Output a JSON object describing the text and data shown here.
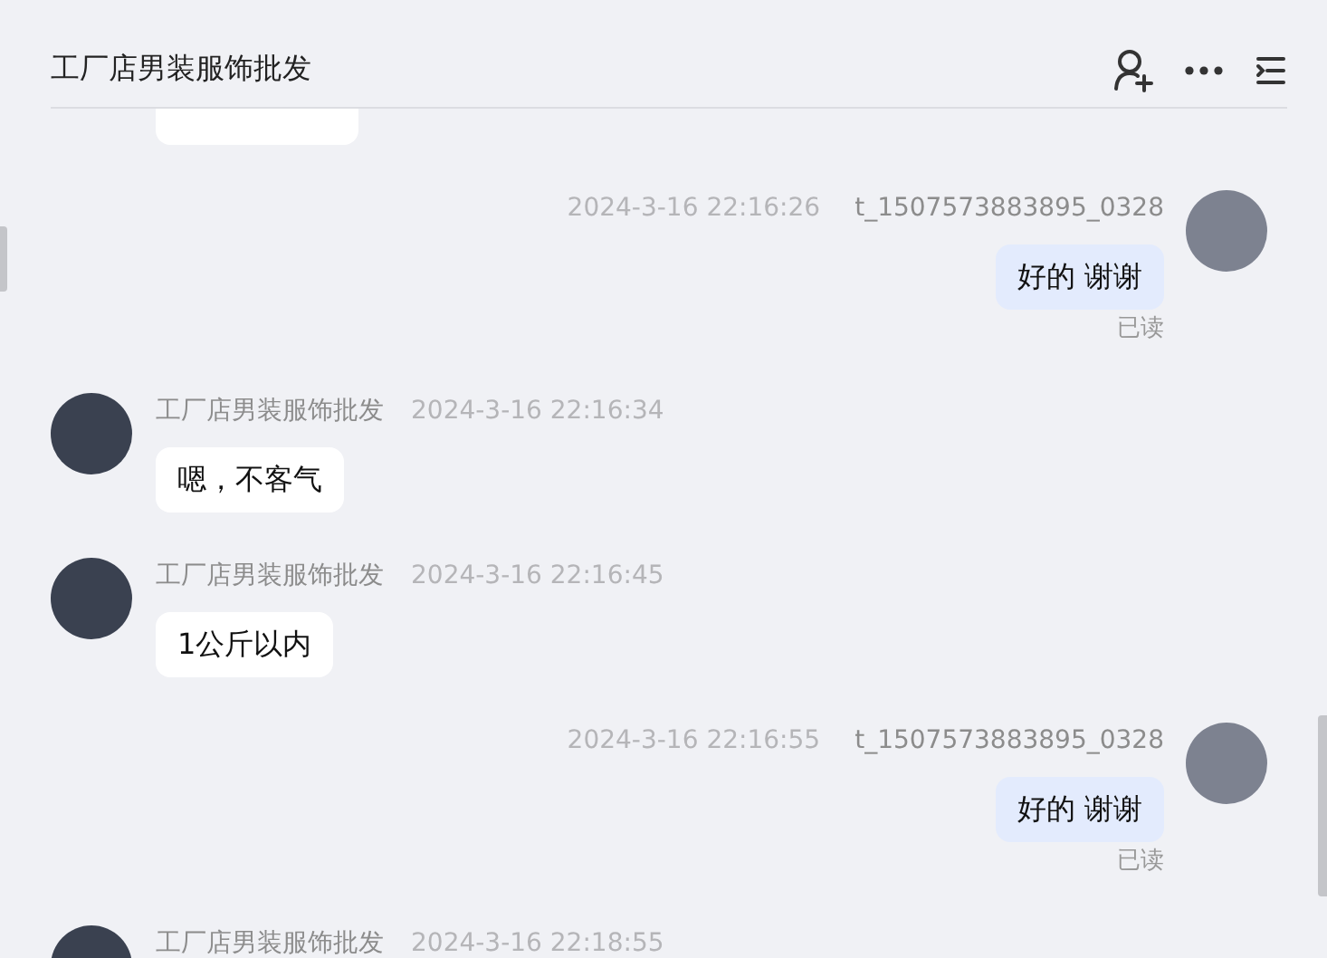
{
  "header": {
    "title": "工厂店男装服饰批发"
  },
  "messages": [
    {
      "kind": "incoming"
    },
    {
      "kind": "outgoing",
      "time": "2024-3-16 22:16:26",
      "name": "t_1507573883895_0328",
      "text": "好的 谢谢",
      "status": "已读"
    },
    {
      "kind": "incoming",
      "name": "工厂店男装服饰批发",
      "time": "2024-3-16 22:16:34",
      "text": "嗯，不客气"
    },
    {
      "kind": "incoming",
      "name": "工厂店男装服饰批发",
      "time": "2024-3-16 22:16:45",
      "text": "1公斤以内"
    },
    {
      "kind": "outgoing",
      "time": "2024-3-16 22:16:55",
      "name": "t_1507573883895_0328",
      "text": "好的 谢谢",
      "status": "已读"
    },
    {
      "kind": "incoming",
      "name": "工厂店男装服饰批发",
      "time": "2024-3-16 22:18:55"
    }
  ]
}
